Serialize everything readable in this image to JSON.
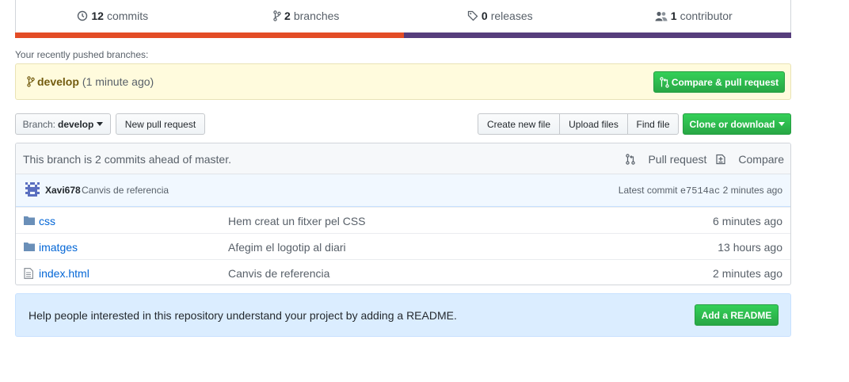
{
  "summary": {
    "commits_count": "12",
    "commits_label": "commits",
    "branches_count": "2",
    "branches_label": "branches",
    "releases_count": "0",
    "releases_label": "releases",
    "contributors_count": "1",
    "contributors_label": "contributor"
  },
  "languages": [
    {
      "color": "#e34c26",
      "share": 0.5
    },
    {
      "color": "#563d7c",
      "share": 0.5
    }
  ],
  "recent": {
    "label": "Your recently pushed branches:",
    "branch": "develop",
    "time": "(1 minute ago)",
    "compare_button": "Compare & pull request"
  },
  "toolbar": {
    "branch_prefix": "Branch:",
    "branch_name": "develop",
    "new_pr": "New pull request",
    "create_file": "Create new file",
    "upload_files": "Upload files",
    "find_file": "Find file",
    "clone": "Clone or download"
  },
  "ahead": {
    "message": "This branch is 2 commits ahead of master.",
    "pull_request": "Pull request",
    "compare": "Compare"
  },
  "latest_commit": {
    "author": "Xavi678",
    "message": "Canvis de referencia",
    "prefix": "Latest commit",
    "sha": "e7514ac",
    "time": "2 minutes ago"
  },
  "files": [
    {
      "type": "folder",
      "name": "css",
      "message": "Hem creat un fitxer pel CSS",
      "age": "6 minutes ago"
    },
    {
      "type": "folder",
      "name": "imatges",
      "message": "Afegim el logotip al diari",
      "age": "13 hours ago"
    },
    {
      "type": "file",
      "name": "index.html",
      "message": "Canvis de referencia",
      "age": "2 minutes ago"
    }
  ],
  "readme": {
    "text": "Help people interested in this repository understand your project by adding a README.",
    "button": "Add a README"
  },
  "colors": {
    "green": "#28a745",
    "link": "#0366d6",
    "recent_bg": "#fffbdd",
    "readme_bg": "#dbedff"
  }
}
